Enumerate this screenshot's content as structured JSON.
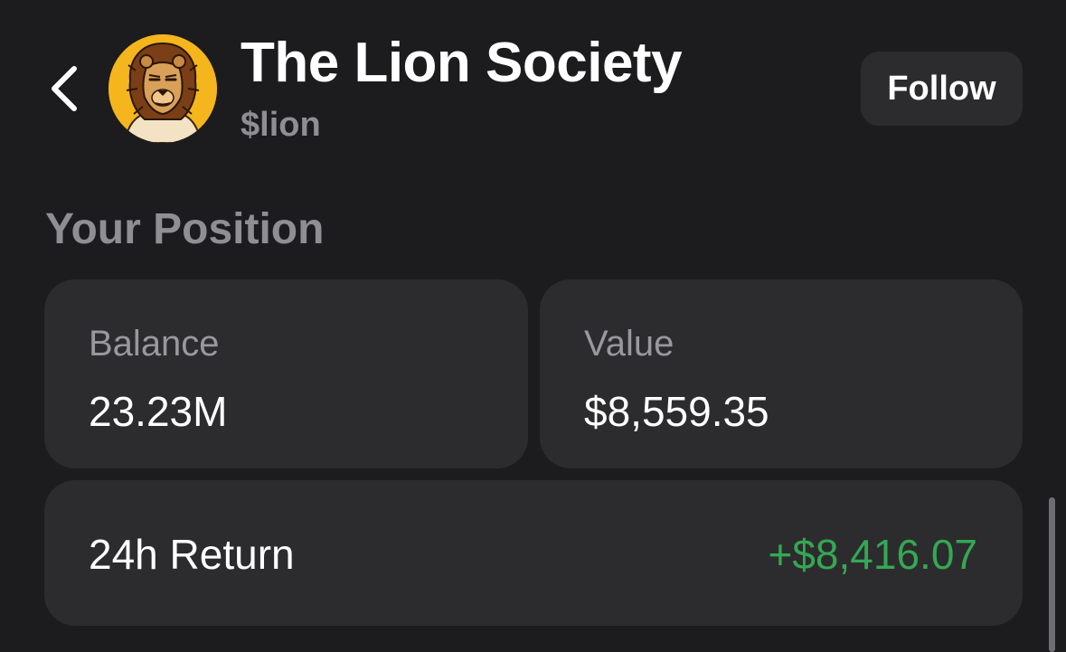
{
  "header": {
    "title": "The Lion Society",
    "ticker": "$lion",
    "follow_label": "Follow",
    "avatar_icon": "lion-avatar-icon",
    "back_icon": "chevron-left-icon"
  },
  "position": {
    "section_title": "Your Position",
    "balance": {
      "label": "Balance",
      "value": "23.23M"
    },
    "value": {
      "label": "Value",
      "value": "$8,559.35"
    },
    "return_24h": {
      "label": "24h Return",
      "value": "+$8,416.07"
    }
  },
  "colors": {
    "background": "#1c1c1e",
    "card": "#2c2c2e",
    "positive": "#34a853",
    "muted": "#8e8e93",
    "avatar_bg": "#f5b51c"
  }
}
